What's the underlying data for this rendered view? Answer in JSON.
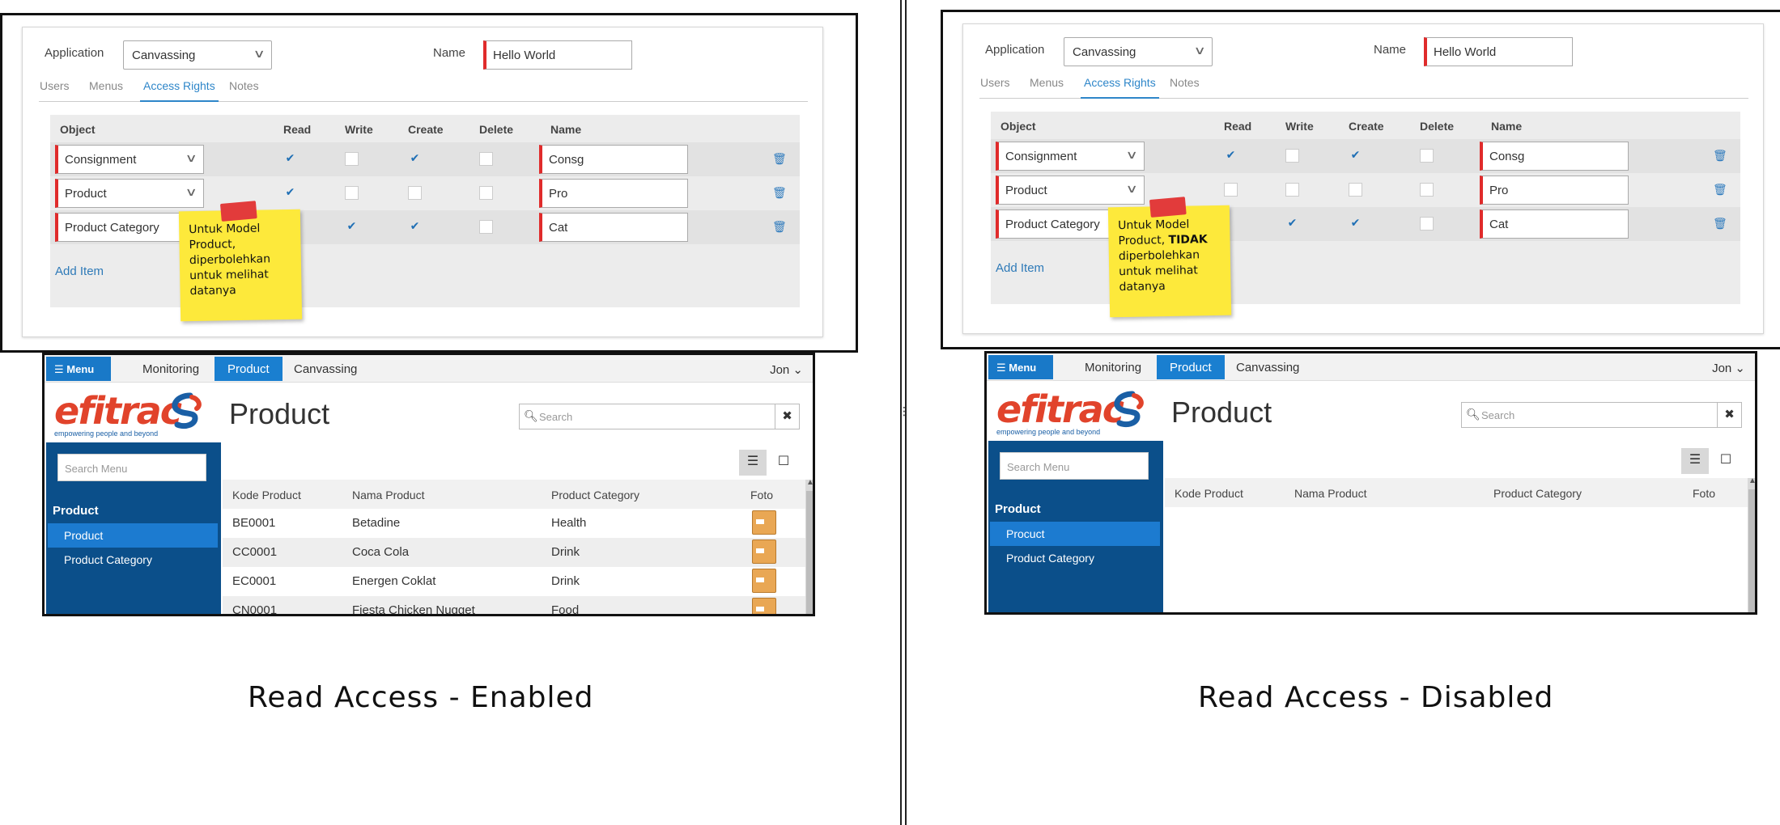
{
  "panels": [
    {
      "form": {
        "application_label": "Application",
        "application_value": "Canvassing",
        "name_label": "Name",
        "name_value": "Hello World",
        "tabs": [
          "Users",
          "Menus",
          "Access Rights",
          "Notes"
        ],
        "active_tab": "Access Rights",
        "columns": [
          "Object",
          "Read",
          "Write",
          "Create",
          "Delete",
          "Name"
        ],
        "rows": [
          {
            "object": "Consignment",
            "read": true,
            "write": false,
            "create": true,
            "delete": false,
            "name": "Consg"
          },
          {
            "object": "Product",
            "read": true,
            "write": false,
            "create": false,
            "delete": false,
            "name": "Pro"
          },
          {
            "object": "Product Category",
            "read": null,
            "write": true,
            "create": true,
            "delete": false,
            "name": "Cat"
          }
        ],
        "add_item": "Add Item"
      },
      "note": {
        "line1": "Untuk Model",
        "line2": "Product,",
        "line2_bold": "",
        "line3": "diperbolehkan",
        "line4": "untuk melihat",
        "line5": "datanya"
      },
      "app": {
        "menu_label": "Menu",
        "nav": [
          "Monitoring",
          "Product",
          "Canvassing"
        ],
        "active_nav": "Product",
        "user": "Jon",
        "logo_text": "efitrac",
        "logo_tagline": "empowering people and beyond",
        "page_title": "Product",
        "search_placeholder": "Search",
        "sidebar_search_placeholder": "Search Menu",
        "sidebar_heading": "Product",
        "sidebar_items": [
          "Product",
          "Product Category"
        ],
        "table_headers": [
          "Kode Product",
          "Nama Product",
          "Product Category",
          "Foto"
        ],
        "table_rows": [
          [
            "BE0001",
            "Betadine",
            "Health"
          ],
          [
            "CC0001",
            "Coca Cola",
            "Drink"
          ],
          [
            "EC0001",
            "Energen Coklat",
            "Drink"
          ],
          [
            "CN0001",
            "Fiesta Chicken Nugget",
            "Food"
          ]
        ]
      },
      "caption": "Read Access - Enabled"
    },
    {
      "form": {
        "application_label": "Application",
        "application_value": "Canvassing",
        "name_label": "Name",
        "name_value": "Hello World",
        "tabs": [
          "Users",
          "Menus",
          "Access Rights",
          "Notes"
        ],
        "active_tab": "Access Rights",
        "columns": [
          "Object",
          "Read",
          "Write",
          "Create",
          "Delete",
          "Name"
        ],
        "rows": [
          {
            "object": "Consignment",
            "read": true,
            "write": false,
            "create": true,
            "delete": false,
            "name": "Consg"
          },
          {
            "object": "Product",
            "read": false,
            "write": false,
            "create": false,
            "delete": false,
            "name": "Pro"
          },
          {
            "object": "Product Category",
            "read": null,
            "write": true,
            "create": true,
            "delete": false,
            "name": "Cat"
          }
        ],
        "add_item": "Add Item"
      },
      "note": {
        "line1": "Untuk Model",
        "line2": "Product, ",
        "line2_bold": "TIDAK",
        "line3": "diperbolehkan",
        "line4": "untuk melihat",
        "line5": "datanya"
      },
      "app": {
        "menu_label": "Menu",
        "nav": [
          "Monitoring",
          "Product",
          "Canvassing"
        ],
        "active_nav": "Product",
        "user": "Jon",
        "logo_text": "efitrac",
        "logo_tagline": "empowering people and beyond",
        "page_title": "Product",
        "search_placeholder": "Search",
        "sidebar_search_placeholder": "Search Menu",
        "sidebar_heading": "Product",
        "sidebar_items": [
          "Procuct",
          "Product Category"
        ],
        "table_headers": [
          "Kode Product",
          "Nama Product",
          "Product Category",
          "Foto"
        ],
        "table_rows": []
      },
      "caption": "Read Access - Disabled"
    }
  ],
  "colors": {
    "accent": "#1a7fd0",
    "sidebar": "#0b4f8a",
    "required": "#e02b2b",
    "note": "#fde93b",
    "brand": "#e1432b"
  }
}
